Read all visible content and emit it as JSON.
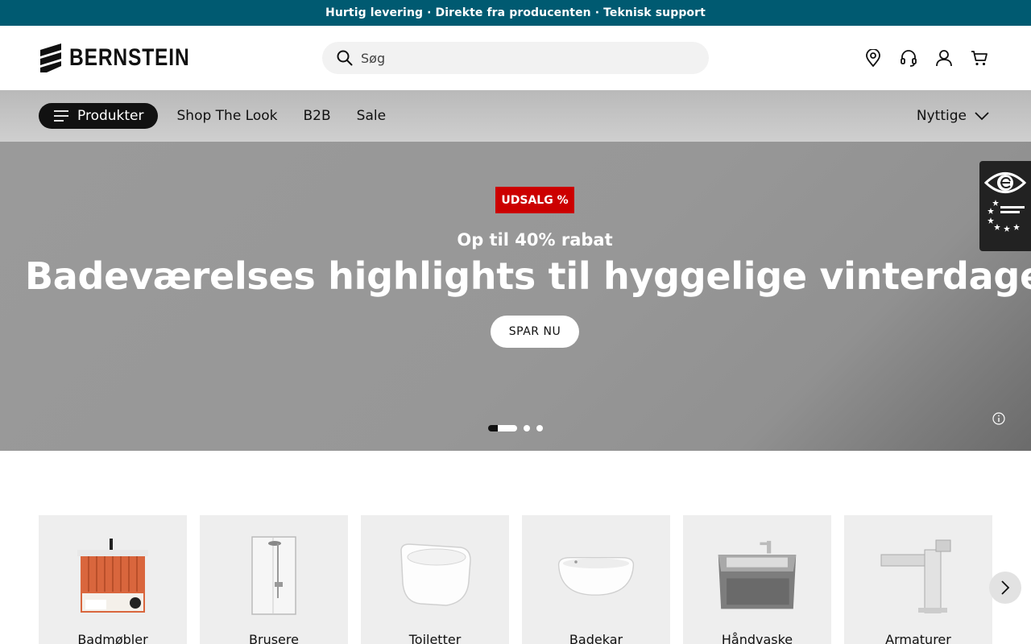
{
  "topbar": {
    "text": "Hurtig levering · Direkte fra producenten · Teknisk support"
  },
  "header": {
    "logo_text": "BERNSTEIN",
    "search_placeholder": "Søg",
    "icons": [
      "location-pin-icon",
      "headset-icon",
      "user-icon",
      "cart-icon"
    ]
  },
  "nav": {
    "products_label": "Produkter",
    "links": [
      "Shop The Look",
      "B2B",
      "Sale"
    ],
    "right_label": "Nyttige"
  },
  "hero": {
    "badge": "UDSALG %",
    "subtitle": "Op til 40% rabat",
    "title": "Badeværelses highlights til hyggelige vinterdage",
    "cta": "SPAR NU",
    "slide_count": 3,
    "active_slide": 1
  },
  "categories": [
    {
      "label": "Badmøbler"
    },
    {
      "label": "Brusere"
    },
    {
      "label": "Toiletter"
    },
    {
      "label": "Badekar"
    },
    {
      "label": "Håndvaske"
    },
    {
      "label": "Armaturer"
    }
  ],
  "colors": {
    "topbar": "#005a71",
    "badge": "#cc0000",
    "dark": "#111111"
  }
}
